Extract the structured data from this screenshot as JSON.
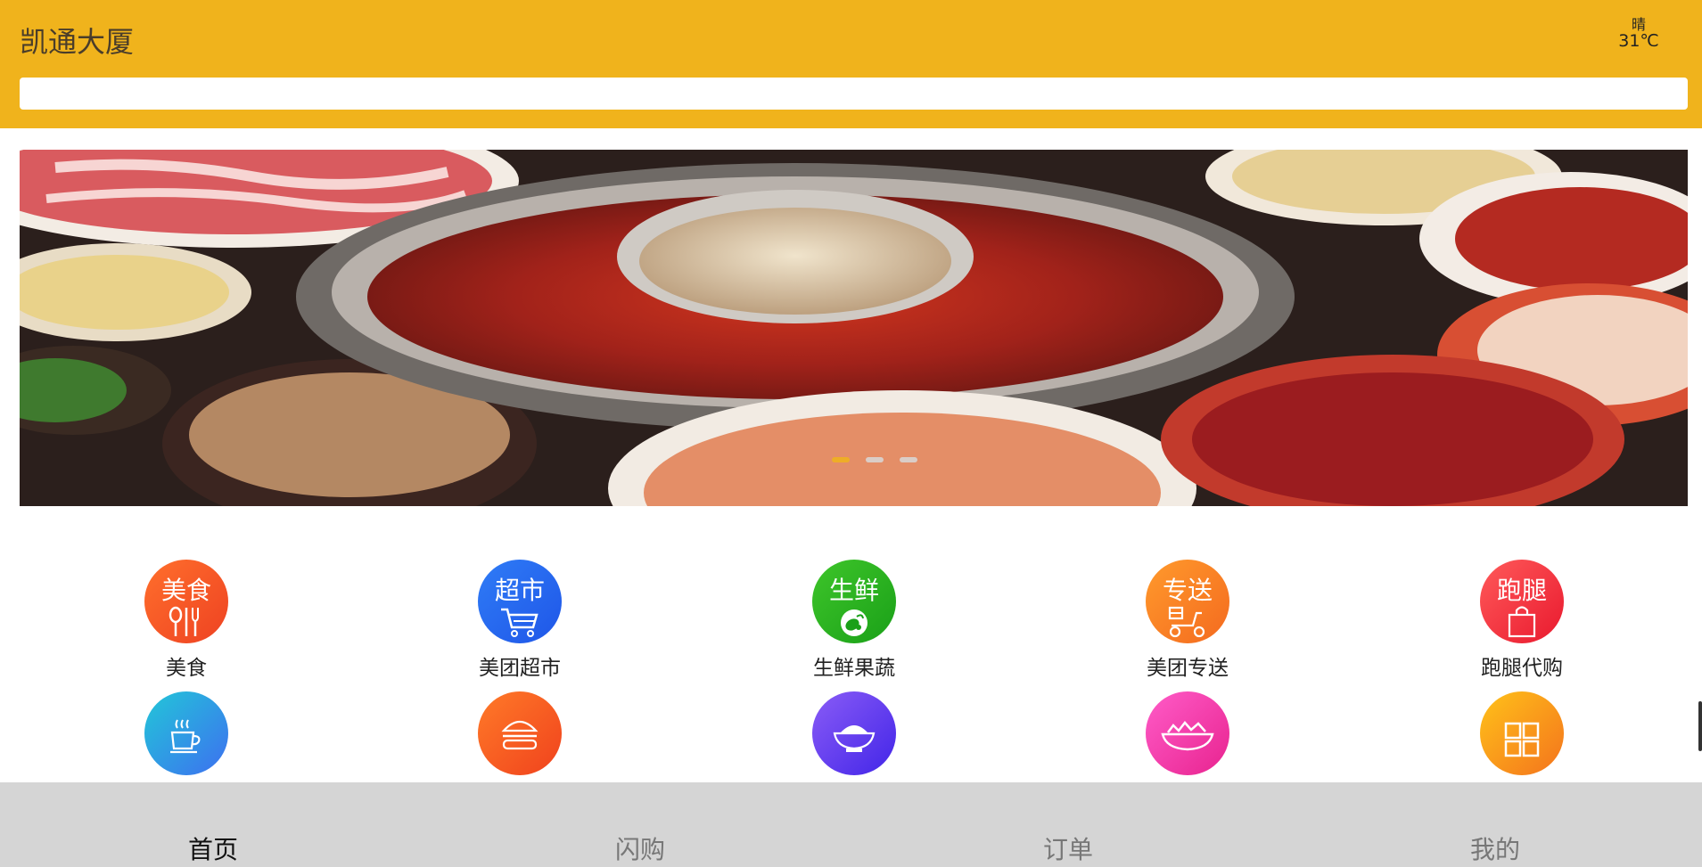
{
  "header": {
    "location": "凯通大厦",
    "weather": {
      "condition": "晴",
      "temperature": "31℃"
    },
    "search_placeholder": "",
    "background_color": "#f0b31c"
  },
  "banner": {
    "image_description_icon": "hotpot-banner-image",
    "slides_count": 3,
    "active_slide": 1
  },
  "categories": [
    {
      "label": "美食",
      "badge": "美食",
      "icon": "fork-spoon-icon",
      "color_from": "#ff6f2c",
      "color_to": "#ee4222"
    },
    {
      "label": "美团超市",
      "badge": "超市",
      "icon": "shopping-cart-icon",
      "color_from": "#2f7cf6",
      "color_to": "#1f56e8"
    },
    {
      "label": "生鲜果蔬",
      "badge": "生鲜",
      "icon": "vegetable-icon",
      "color_from": "#3ec52a",
      "color_to": "#1aa018"
    },
    {
      "label": "美团专送",
      "badge": "专送",
      "icon": "scooter-icon",
      "color_from": "#ff9a2c",
      "color_to": "#f46a1f"
    },
    {
      "label": "跑腿代购",
      "badge": "跑腿",
      "icon": "shopping-bag-icon",
      "color_from": "#ff5a5a",
      "color_to": "#e9192e"
    },
    {
      "label": "",
      "badge": "",
      "icon": "coffee-cup-icon",
      "color_from": "#22c7d8",
      "color_to": "#3d6ff0"
    },
    {
      "label": "",
      "badge": "",
      "icon": "burger-icon",
      "color_from": "#ff7a28",
      "color_to": "#f0421d"
    },
    {
      "label": "",
      "badge": "",
      "icon": "rice-bowl-icon",
      "color_from": "#8a5cf6",
      "color_to": "#4225e8"
    },
    {
      "label": "",
      "badge": "",
      "icon": "salad-bowl-icon",
      "color_from": "#ff5cc8",
      "color_to": "#e8238f"
    },
    {
      "label": "",
      "badge": "",
      "icon": "grid-icon",
      "color_from": "#ffc21a",
      "color_to": "#f4731c"
    }
  ],
  "tabbar": {
    "tabs": [
      {
        "label": "首页",
        "active": true
      },
      {
        "label": "闪购",
        "active": false
      },
      {
        "label": "订单",
        "active": false
      },
      {
        "label": "我的",
        "active": false
      }
    ]
  }
}
